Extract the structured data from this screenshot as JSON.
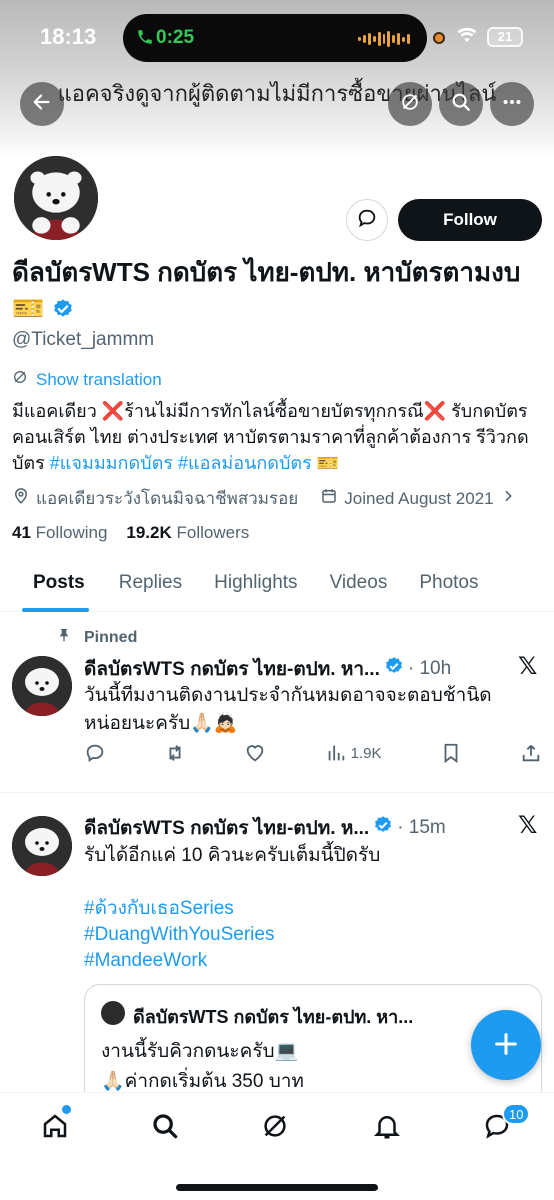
{
  "status_bar": {
    "time": "18:13",
    "call_time": "0:25",
    "battery": "21"
  },
  "header": {
    "banner_title": "แอคจริงดูจากผู้ติดตามไม่มีการซื้อขายผ่านไลน์",
    "back_icon": "arrow-left-icon",
    "grok_icon": "slash-circle-icon",
    "search_icon": "search-icon",
    "more_icon": "more-horizontal-icon"
  },
  "profile": {
    "display_name": "ดีลบัตรWTS กดบัตร ไทย-ตปท. หาบัตรตามงบ🎫",
    "handle": "@Ticket_jammm",
    "follow_label": "Follow",
    "show_translation": "Show translation",
    "bio_text": "มีแอคเดียว ❌ร้านไม่มีการทักไลน์ซื้อขายบัตรทุกกรณี❌ รับกดบัตรคอนเสิร์ต ไทย ต่างประเทศ หาบัตรตามราคาที่ลูกค้าต้องการ รีวิวกดบัตร ",
    "bio_tag_1": "#แจมมมกดบัตร",
    "bio_tag_2": "#แอลม่อนกดบัตร",
    "bio_end": " 🎫",
    "location": "แอคเดียวระวังโดนมิจฉาชีพสวมรอย",
    "joined": "Joined August 2021",
    "following_count": "41",
    "following_label": "Following",
    "followers_count": "19.2K",
    "followers_label": "Followers"
  },
  "tabs": [
    {
      "label": "Posts",
      "active": true
    },
    {
      "label": "Replies",
      "active": false
    },
    {
      "label": "Highlights",
      "active": false
    },
    {
      "label": "Videos",
      "active": false
    },
    {
      "label": "Photos",
      "active": false
    }
  ],
  "posts": [
    {
      "pinned_label": "Pinned",
      "author": "ดีลบัตรWTS กดบัตร ไทย-ตปท. หา...",
      "time": "· 10h",
      "text": "วันนี้ทีมงานติดงานประจำกันหมดอาจจะตอบช้านิดหน่อยนะครับ🙏🏻🙇🏻",
      "views": "1.9K"
    },
    {
      "author": "ดีลบัตรWTS กดบัตร ไทย-ตปท. ห...",
      "time": "· 15m",
      "text": "รับได้อีกแค่ 10 คิวนะครับเต็มนี้ปิดรับ",
      "tags": [
        "#ด้วงกับเธอSeries",
        "#DuangWithYouSeries",
        "#MandeeWork"
      ],
      "quote": {
        "author": "ดีลบัตรWTS กดบัตร ไทย-ตปท. หา...",
        "line1": "งานนี้รับคิวกดนะครับ💻",
        "line2": "🙏🏻ค่ากดเริ่มต้น 350 บาท"
      }
    }
  ],
  "bottom_nav": {
    "messages_badge": "10"
  },
  "colors": {
    "accent": "#1d9bf0",
    "text": "#0f1419",
    "muted": "#536471"
  }
}
